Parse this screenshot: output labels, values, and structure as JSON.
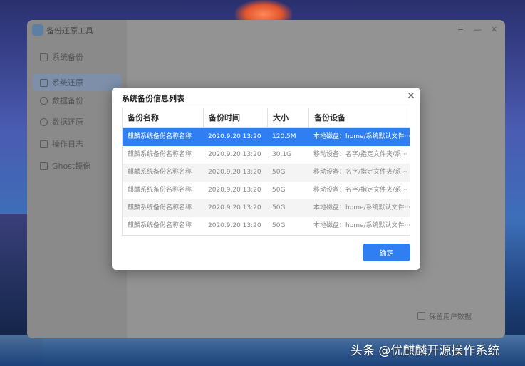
{
  "app": {
    "title": "备份还原工具",
    "window_controls": {
      "menu": "≡",
      "minimize": "—",
      "close": "✕"
    }
  },
  "sidebar": {
    "items": [
      {
        "label": "系统备份",
        "icon": "save-icon",
        "active": false
      },
      {
        "label": "系统还原",
        "icon": "restore-icon",
        "active": true
      },
      {
        "label": "数据备份",
        "icon": "pie-icon",
        "active": false
      },
      {
        "label": "数据还原",
        "icon": "refresh-icon",
        "active": false
      },
      {
        "label": "操作日志",
        "icon": "grid-icon",
        "active": false
      },
      {
        "label": "Ghost镜像",
        "icon": "ghost-icon",
        "active": false
      }
    ]
  },
  "main": {
    "keep_user_data_label": "保留用户数据"
  },
  "dialog": {
    "title": "系统备份信息列表",
    "close_glyph": "✕",
    "columns": [
      "备份名称",
      "备份时间",
      "大小",
      "备份设备"
    ],
    "rows": [
      {
        "name": "麒麟系统备份名称名称",
        "time": "2020.9.20 13:20",
        "size": "120.5M",
        "device": "本地磁盘：home/系统默认文件···",
        "selected": true
      },
      {
        "name": "麒麟系统备份名称名称",
        "time": "2020.9.20 13:20",
        "size": "30.1G",
        "device": "移动设备：名字/指定文件夹/系···",
        "selected": false
      },
      {
        "name": "麒麟系统备份名称名称",
        "time": "2020.9.20 13:20",
        "size": "50G",
        "device": "移动设备：名字/指定文件夹/系···",
        "selected": false
      },
      {
        "name": "麒麟系统备份名称名称",
        "time": "2020.9.20 13:20",
        "size": "50G",
        "device": "移动设备：名字/指定文件夹/系···",
        "selected": false
      },
      {
        "name": "麒麟系统备份名称名称",
        "time": "2020.9.20 13:20",
        "size": "50G",
        "device": "本地磁盘：home/系统默认文件···",
        "selected": false
      },
      {
        "name": "麒麟系统备份名称名称",
        "time": "2020.9.20 13:20",
        "size": "50G",
        "device": "本地磁盘：home/系统默认文件···",
        "selected": false
      }
    ],
    "ok_label": "确定"
  },
  "watermark": "头条 @优麒麟开源操作系统",
  "colors": {
    "accent": "#2f7ff3",
    "selected_row_text": "#ffffff"
  }
}
